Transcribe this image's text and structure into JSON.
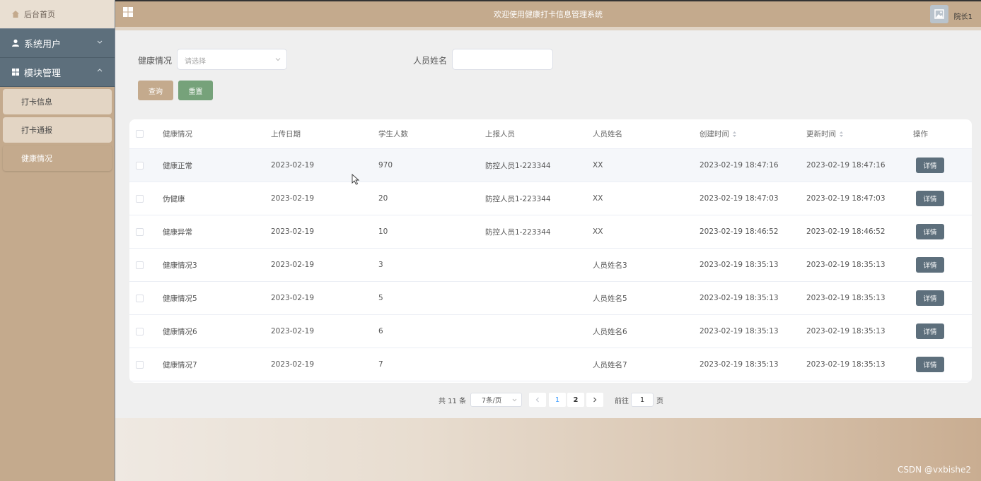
{
  "sidebar": {
    "home_label": "后台首页",
    "groups": [
      {
        "label": "系统用户",
        "icon": "user-icon",
        "expanded": false
      },
      {
        "label": "模块管理",
        "icon": "grid-icon",
        "expanded": true
      }
    ],
    "sub_items": [
      {
        "label": "打卡信息",
        "active": false
      },
      {
        "label": "打卡通报",
        "active": false
      },
      {
        "label": "健康情况",
        "active": true
      }
    ]
  },
  "topbar": {
    "title": "欢迎使用健康打卡信息管理系统",
    "username": "院长1"
  },
  "search": {
    "health_label": "健康情况",
    "health_placeholder": "请选择",
    "name_label": "人员姓名",
    "name_value": "",
    "query_button": "查询",
    "reset_button": "重置"
  },
  "table": {
    "columns": [
      "健康情况",
      "上传日期",
      "学生人数",
      "上报人员",
      "人员姓名",
      "创建时间",
      "更新时间",
      "操作"
    ],
    "rows": [
      {
        "health": "健康正常",
        "date": "2023-02-19",
        "count": "970",
        "reporter": "防控人员1-223344",
        "name": "XX",
        "created": "2023-02-19 18:47:16",
        "updated": "2023-02-19 18:47:16",
        "action": "详情"
      },
      {
        "health": "伪健康",
        "date": "2023-02-19",
        "count": "20",
        "reporter": "防控人员1-223344",
        "name": "XX",
        "created": "2023-02-19 18:47:03",
        "updated": "2023-02-19 18:47:03",
        "action": "详情"
      },
      {
        "health": "健康异常",
        "date": "2023-02-19",
        "count": "10",
        "reporter": "防控人员1-223344",
        "name": "XX",
        "created": "2023-02-19 18:46:52",
        "updated": "2023-02-19 18:46:52",
        "action": "详情"
      },
      {
        "health": "健康情况3",
        "date": "2023-02-19",
        "count": "3",
        "reporter": "",
        "name": "人员姓名3",
        "created": "2023-02-19 18:35:13",
        "updated": "2023-02-19 18:35:13",
        "action": "详情"
      },
      {
        "health": "健康情况5",
        "date": "2023-02-19",
        "count": "5",
        "reporter": "",
        "name": "人员姓名5",
        "created": "2023-02-19 18:35:13",
        "updated": "2023-02-19 18:35:13",
        "action": "详情"
      },
      {
        "health": "健康情况6",
        "date": "2023-02-19",
        "count": "6",
        "reporter": "",
        "name": "人员姓名6",
        "created": "2023-02-19 18:35:13",
        "updated": "2023-02-19 18:35:13",
        "action": "详情"
      },
      {
        "health": "健康情况7",
        "date": "2023-02-19",
        "count": "7",
        "reporter": "",
        "name": "人员姓名7",
        "created": "2023-02-19 18:35:13",
        "updated": "2023-02-19 18:35:13",
        "action": "详情"
      }
    ]
  },
  "pagination": {
    "total": "共 11 条",
    "page_size": "7条/页",
    "pages": [
      "1",
      "2"
    ],
    "current_page": "1",
    "goto_label": "前往",
    "goto_value": "1",
    "page_suffix": "页"
  },
  "watermark": "CSDN @vxbishe2",
  "colors": {
    "accent": "#c4aa8d",
    "sidebar_group": "#5d6f7c",
    "reset_green": "#76a27a",
    "detail_button": "#5d6f7c",
    "active_page": "#409eff"
  }
}
